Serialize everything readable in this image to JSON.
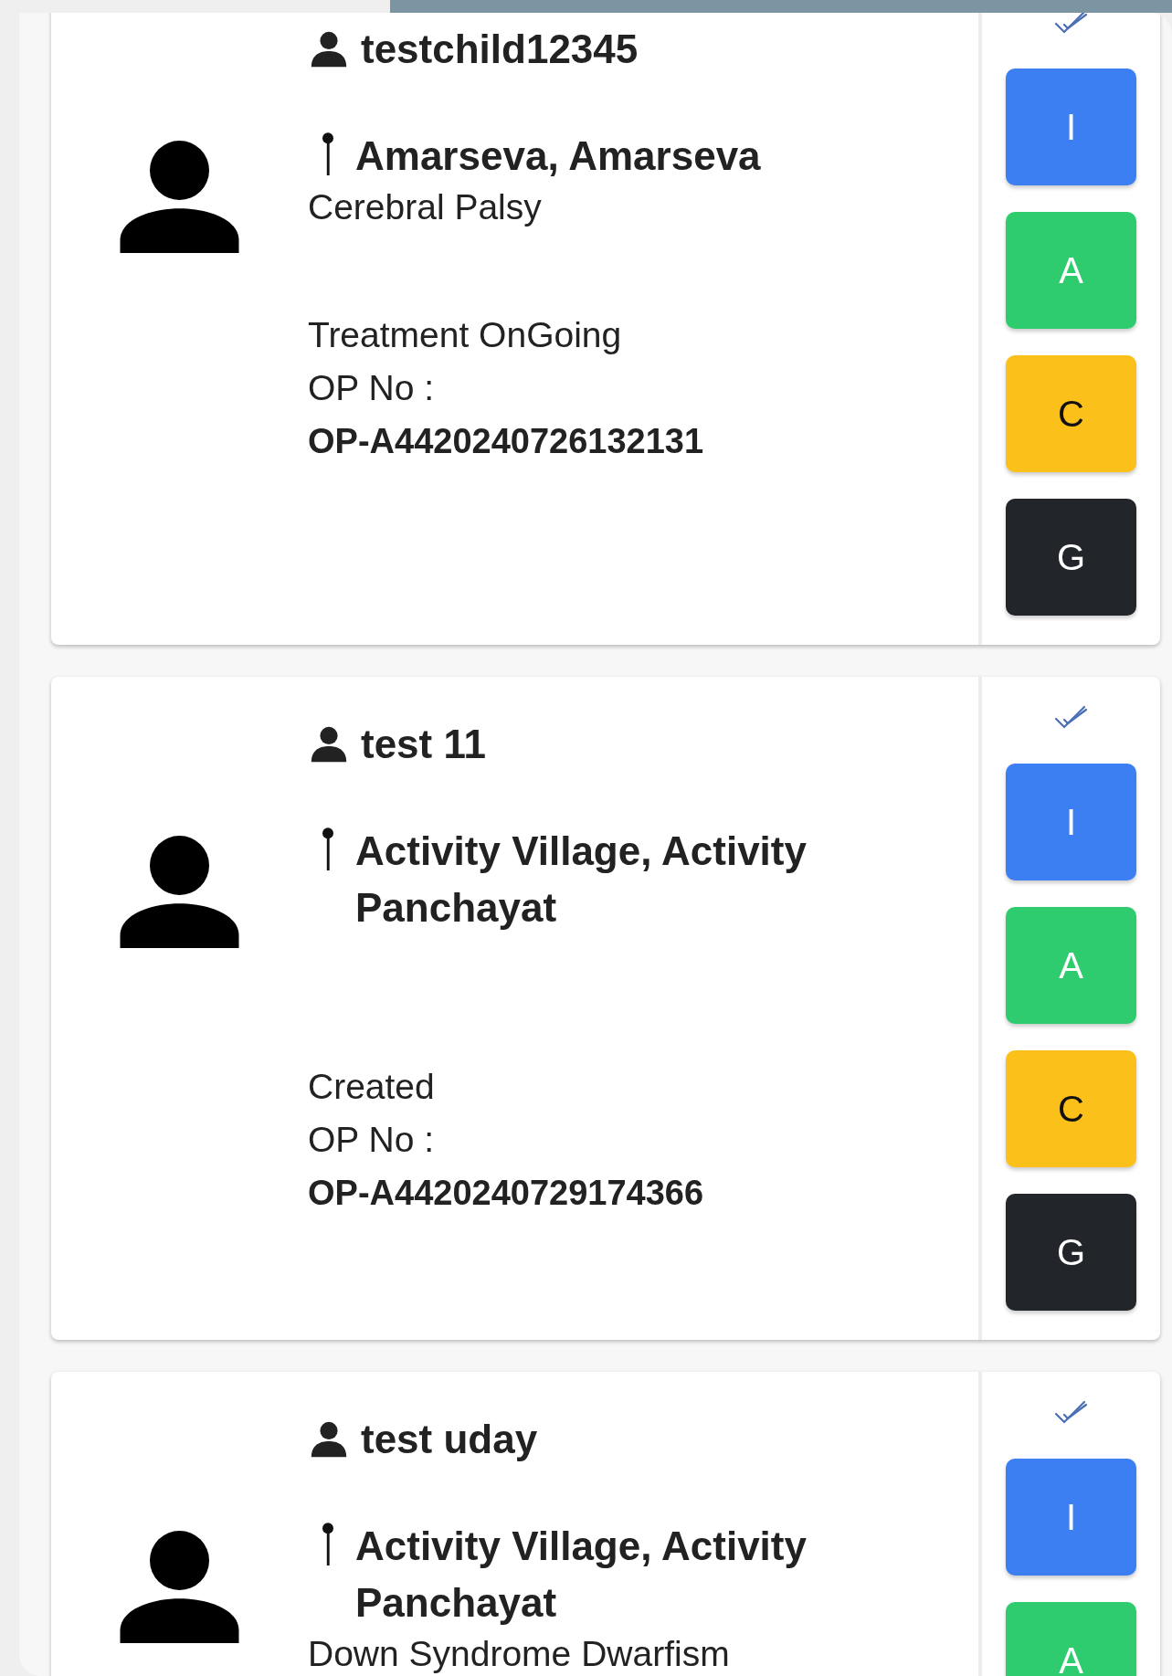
{
  "patients": [
    {
      "name": "testchild12345",
      "location": "Amarseva, Amarseva",
      "diagnosis": "Cerebral Palsy",
      "status": "Treatment OnGoing",
      "op_label": "OP No :",
      "op_number": "OP-A4420240726132131",
      "actions": [
        {
          "label": "I",
          "kind": "info"
        },
        {
          "label": "A",
          "kind": "assess"
        },
        {
          "label": "C",
          "kind": "consult"
        },
        {
          "label": "G",
          "kind": "goal"
        }
      ]
    },
    {
      "name": "test 11",
      "location": "Activity Village, Activity Panchayat",
      "status": "Created",
      "op_label": "OP No :",
      "op_number": "OP-A4420240729174366",
      "actions": [
        {
          "label": "I",
          "kind": "info"
        },
        {
          "label": "A",
          "kind": "assess"
        },
        {
          "label": "C",
          "kind": "consult"
        },
        {
          "label": "G",
          "kind": "goal"
        }
      ]
    },
    {
      "name": "test uday",
      "location": "Activity Village, Activity Panchayat",
      "diagnosis": "Down Syndrome Dwarfism",
      "actions": [
        {
          "label": "I",
          "kind": "info"
        },
        {
          "label": "A",
          "kind": "assess"
        }
      ]
    }
  ]
}
